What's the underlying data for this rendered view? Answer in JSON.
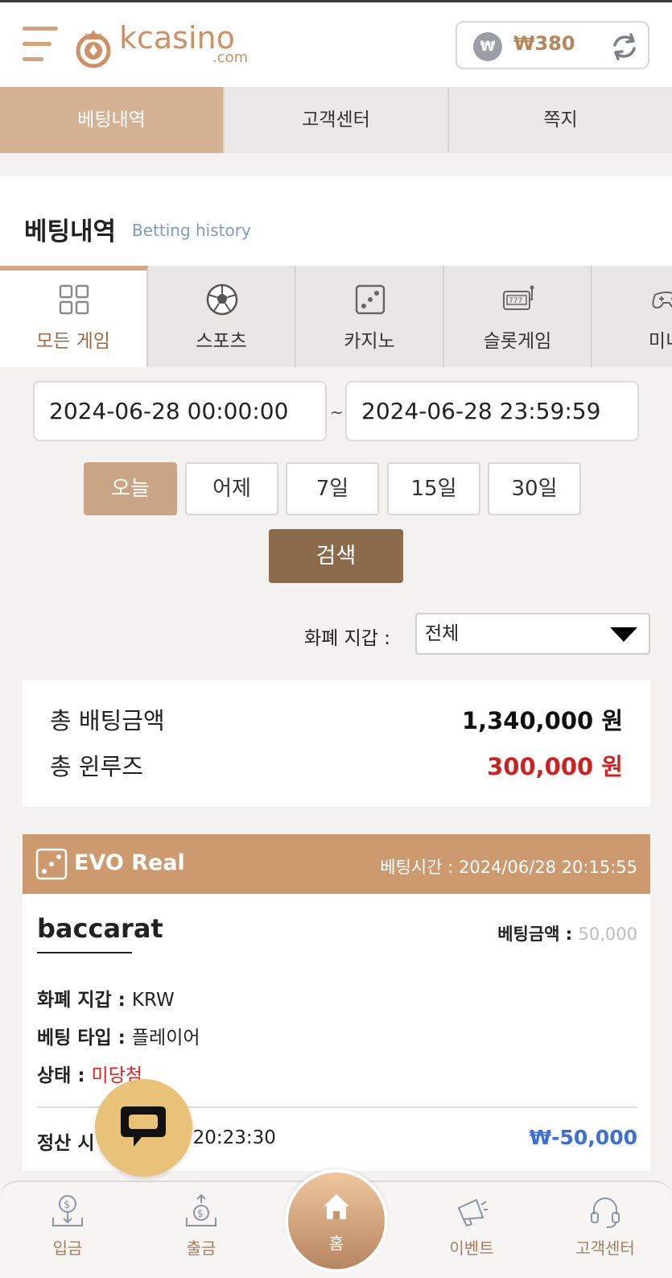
{
  "header": {
    "logo_text": "kcasino",
    "logo_sub": ".com",
    "balance_symbol": "₩",
    "balance_amount": "₩380"
  },
  "top_tabs": [
    "베팅내역",
    "고객센터",
    "쪽지"
  ],
  "section": {
    "title": "베팅내역",
    "subtitle": "Betting history"
  },
  "game_tabs": [
    "모든 게임",
    "스포츠",
    "카지노",
    "슬롯게임",
    "미니"
  ],
  "date_range": {
    "start": "2024-06-28 00:00:00",
    "separator": "~",
    "end": "2024-06-28 23:59:59"
  },
  "quick_ranges": [
    "오늘",
    "어제",
    "7일",
    "15일",
    "30일"
  ],
  "search_label": "검색",
  "wallet": {
    "label": "화폐 지갑 :",
    "selected": "전체"
  },
  "totals": {
    "bet_label": "총 배팅금액",
    "bet_value": "1,340,000 원",
    "winloss_label": "총 윈루즈",
    "winloss_value": "300,000 원"
  },
  "bet_card": {
    "provider": "EVO Real",
    "bet_time": "베팅시간 : 2024/06/28 20:15:55",
    "game": "baccarat",
    "amount_label": "베팅금액 : ",
    "amount_value": "50,000",
    "currency_label": "화폐 지갑 : ",
    "currency_value": "KRW",
    "type_label": "베팅 타입 : ",
    "type_value": "플레이어",
    "status_label": "상태 : ",
    "status_value": "미당첨",
    "settle_label": "정산 시",
    "settle_time": "06/28 20:23:30",
    "settle_amount": "₩-50,000"
  },
  "bottom_nav": {
    "deposit": "입금",
    "withdraw": "출금",
    "home": "홈",
    "event": "이벤트",
    "support": "고객센터"
  },
  "colors": {
    "accent": "#d5b293",
    "brand": "#cf9066",
    "search": "#8c6a4c",
    "red": "#cc2222",
    "blue": "#3d6fd6"
  }
}
